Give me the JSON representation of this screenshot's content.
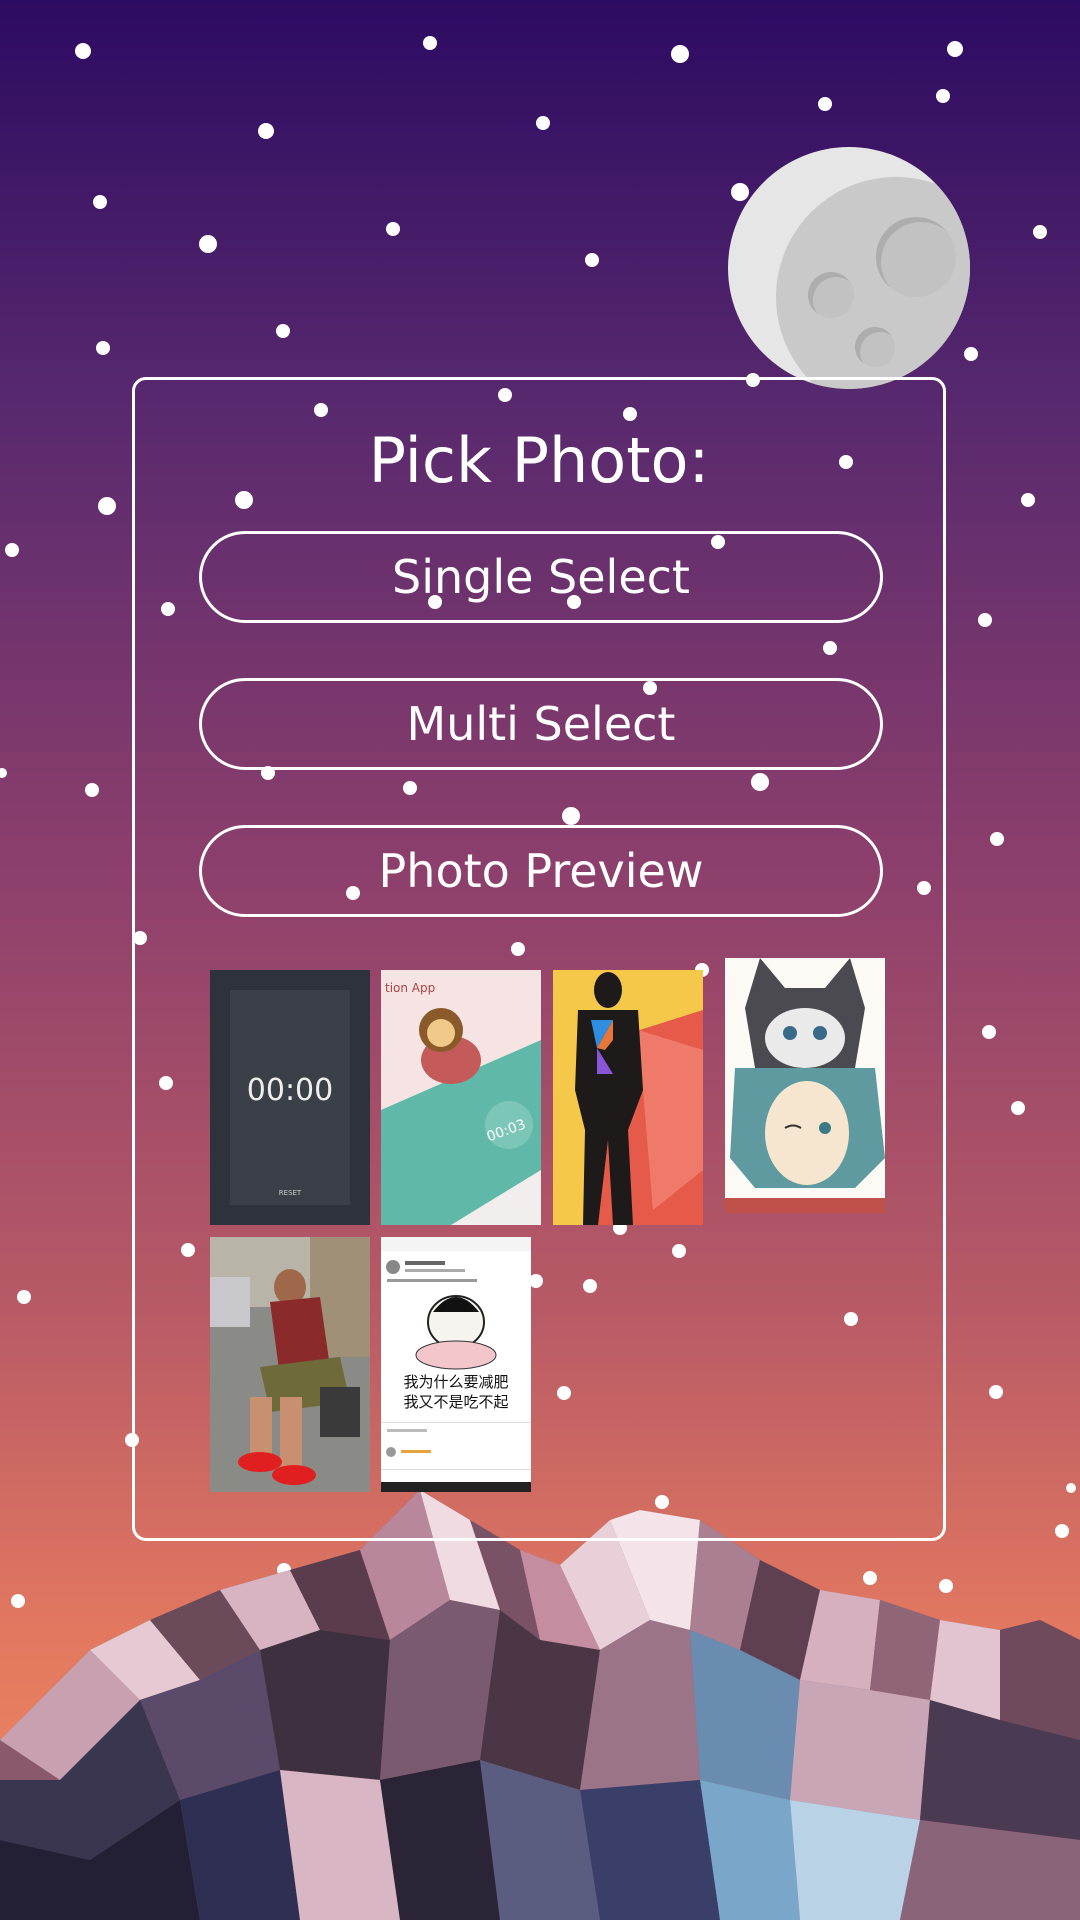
{
  "panel": {
    "title": "Pick Photo:",
    "buttons": [
      {
        "label": "Single Select"
      },
      {
        "label": "Multi Select"
      },
      {
        "label": "Photo Preview"
      }
    ]
  },
  "photos": [
    {
      "semantic": "timer-app-screenshot",
      "timer_text": "00:00",
      "reset_label": "RESET"
    },
    {
      "semantic": "monkey-meditation-app-screenshot",
      "partial_text": "tion App",
      "timer_text": "00:03"
    },
    {
      "semantic": "kotlin-superhero-illustration"
    },
    {
      "semantic": "anime-boy-with-husky-hat"
    },
    {
      "semantic": "man-tying-red-sneakers-photo"
    },
    {
      "semantic": "chinese-social-post-screenshot",
      "caption_line1": "我为什么要减肥",
      "caption_line2": "我又不是吃不起"
    }
  ],
  "colors": {
    "background_top": "#2c0b62",
    "background_bottom": "#f08a5e",
    "accent_white": "#ffffff",
    "moon": "#e6e6e6"
  }
}
